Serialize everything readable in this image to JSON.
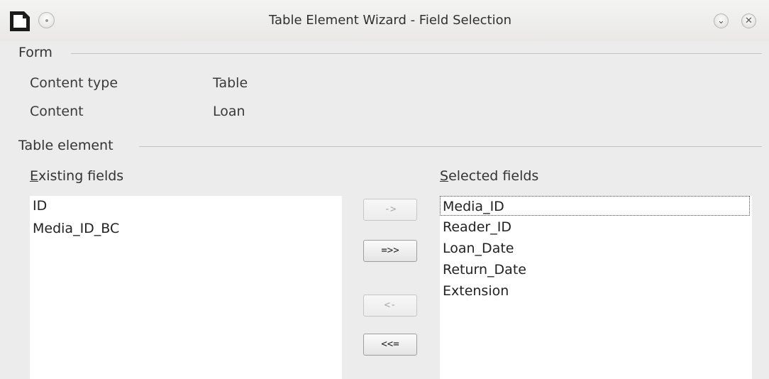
{
  "window": {
    "title": "Table Element Wizard - Field Selection",
    "minimize_glyph": "⌄",
    "close_glyph": "✕"
  },
  "form": {
    "section_label": "Form",
    "content_type_label": "Content type",
    "content_type_value": "Table",
    "content_label": "Content",
    "content_value": "Loan"
  },
  "table_element": {
    "section_label": "Table element",
    "existing": {
      "label_mnemonic": "E",
      "label_rest": "xisting fields",
      "items": [
        "ID",
        "Media_ID_BC"
      ]
    },
    "selected": {
      "label_mnemonic": "S",
      "label_rest": "elected fields",
      "items": [
        "Media_ID",
        "Reader_ID",
        "Loan_Date",
        "Return_Date",
        "Extension"
      ]
    },
    "buttons": {
      "add_one": "->",
      "add_all": "=>>",
      "remove_one": "<-",
      "remove_all": "<<="
    }
  },
  "icons": {
    "app": "document-icon",
    "window_menu": "window-menu-icon",
    "minimize": "chevron-down-icon",
    "close": "close-icon"
  }
}
